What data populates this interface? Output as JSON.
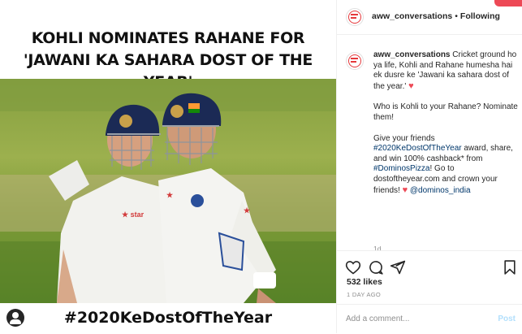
{
  "post_image": {
    "headline_line1": "KOHLI NOMINATES RAHANE FOR",
    "headline_line2": "'JAWANI KA SAHARA DOST OF THE YEAR'",
    "footer_hashtag": "#2020KeDostOfTheYear",
    "photo_icon": "cricket-players-photo",
    "user_icon": "user-tag-icon"
  },
  "header": {
    "username": "aww_conversations",
    "separator": "•",
    "follow_label": "Following"
  },
  "caption": {
    "username": "aww_conversations",
    "p1_text": "Cricket ground ho ya life, Kohli and Rahane humesha hai ek dusre ke 'Jawani ka sahara dost of the year.'",
    "p2_text": "Who is Kohli to your Rahane? Nominate them!",
    "p3_a": "Give your friends",
    "p3_tag1": "#2020KeDostOfTheYear",
    "p3_b": "award, share, and win 100% cashback* from",
    "p3_tag2": "#DominosPizza",
    "p3_c": "! Go to dostoftheyear.com and crown your friends!",
    "p3_mention": "@dominos_india",
    "time_ago": "1d"
  },
  "actions": {
    "likes": "532 likes",
    "date": "1 DAY AGO"
  },
  "comment": {
    "placeholder": "Add a comment...",
    "post_label": "Post"
  },
  "colors": {
    "heart_red": "#ed4956",
    "link_blue": "#00376b",
    "muted_gray": "#8e8e8e",
    "post_disabled": "#b2dffc"
  }
}
